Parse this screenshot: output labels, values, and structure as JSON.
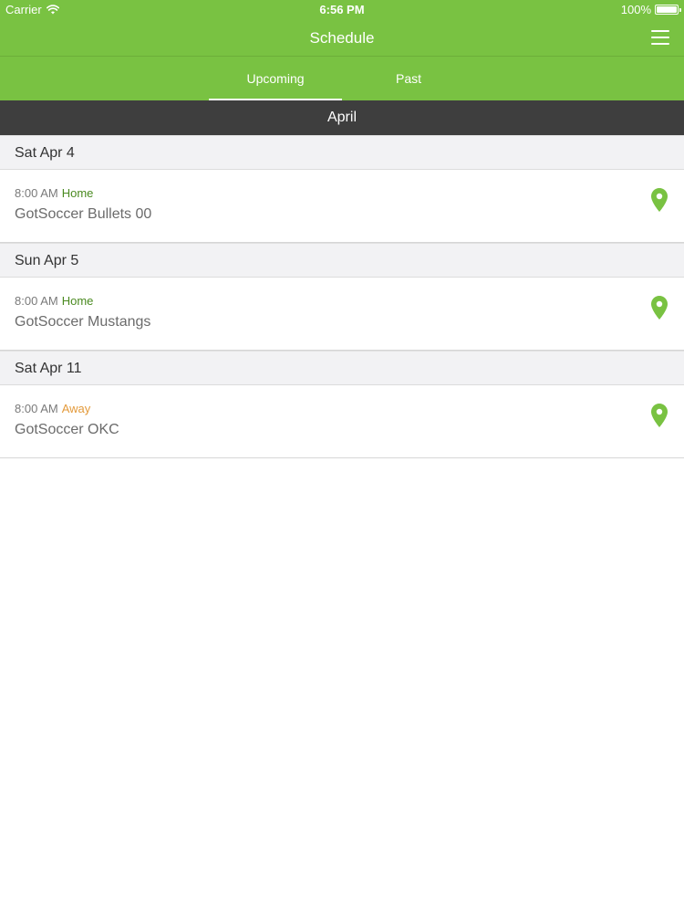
{
  "status_bar": {
    "carrier": "Carrier",
    "time": "6:56 PM",
    "battery": "100%",
    "battery_level": 1.0
  },
  "nav": {
    "title": "Schedule",
    "menu_icon": "hamburger-menu-icon"
  },
  "tabs": [
    {
      "label": "Upcoming",
      "selected": true
    },
    {
      "label": "Past",
      "selected": false
    }
  ],
  "month": "April",
  "days": [
    {
      "date": "Sat Apr 4",
      "games": [
        {
          "time": "8:00 AM",
          "venue": "Home",
          "opponent": "GotSoccer Bullets 00",
          "icon": "map-pin-icon"
        }
      ]
    },
    {
      "date": "Sun Apr 5",
      "games": [
        {
          "time": "8:00 AM",
          "venue": "Home",
          "opponent": "GotSoccer Mustangs",
          "icon": "map-pin-icon"
        }
      ]
    },
    {
      "date": "Sat Apr 11",
      "games": [
        {
          "time": "8:00 AM",
          "venue": "Away",
          "opponent": "GotSoccer OKC",
          "icon": "map-pin-icon"
        }
      ]
    }
  ],
  "colors": {
    "brand_green": "#79c242",
    "month_bar": "#3e3e3e",
    "home": "#4a8a20",
    "away": "#e39a3b",
    "pin": "#79c242"
  }
}
